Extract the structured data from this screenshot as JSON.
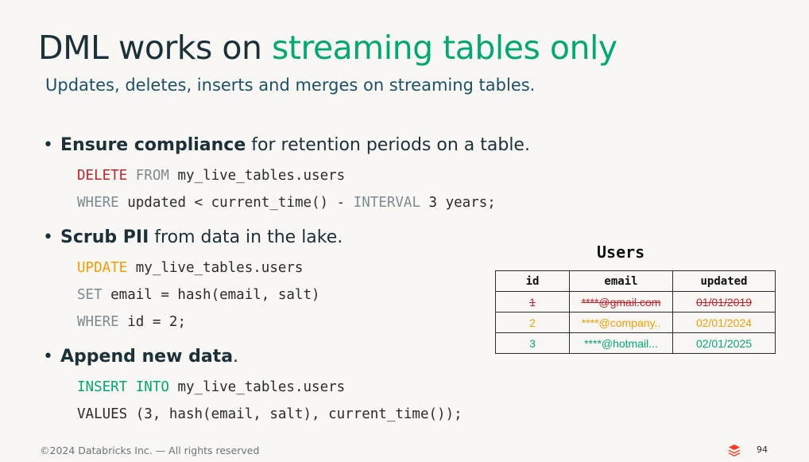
{
  "title": {
    "part1": "DML works on ",
    "part2": "streaming tables only"
  },
  "subtitle": "Updates, deletes, inserts and merges on streaming tables.",
  "bullets": [
    {
      "bold": "Ensure compliance",
      "rest": " for retention periods on a table.",
      "code": [
        [
          {
            "t": "DELETE",
            "c": "red"
          },
          {
            "t": " "
          },
          {
            "t": "FROM",
            "c": "grey"
          },
          {
            "t": " my_live_tables.users"
          }
        ],
        [
          {
            "t": "WHERE",
            "c": "grey"
          },
          {
            "t": " updated < current_time() - "
          },
          {
            "t": "INTERVAL",
            "c": "grey"
          },
          {
            "t": " 3 years;"
          }
        ]
      ]
    },
    {
      "bold": "Scrub PII",
      "rest": " from data in the lake.",
      "code": [
        [
          {
            "t": "UPDATE",
            "c": "orange"
          },
          {
            "t": " my_live_tables.users"
          }
        ],
        [
          {
            "t": "SET",
            "c": "grey"
          },
          {
            "t": " email = hash(email, salt)"
          }
        ],
        [
          {
            "t": "WHERE",
            "c": "grey"
          },
          {
            "t": " id = 2;"
          }
        ]
      ]
    },
    {
      "bold": "Append new data",
      "rest": ".",
      "code": [
        [
          {
            "t": "INSERT",
            "c": "green"
          },
          {
            "t": " "
          },
          {
            "t": "INTO",
            "c": "green"
          },
          {
            "t": " my_live_tables.users"
          }
        ],
        [
          {
            "t": "VALUES (3, hash(email, salt), current_time());"
          }
        ]
      ]
    }
  ],
  "table": {
    "title": "Users",
    "headers": [
      "id",
      "email",
      "updated"
    ],
    "rows": [
      {
        "status": "deleted",
        "cells": [
          "1",
          "****@gmail.com",
          "01/01/2019"
        ]
      },
      {
        "status": "updated",
        "cells": [
          "2",
          "****@company..",
          "02/01/2024"
        ]
      },
      {
        "status": "inserted",
        "cells": [
          "3",
          "****@hotmail...",
          "02/01/2025"
        ]
      }
    ]
  },
  "colors": {
    "accent_green": "#00a972",
    "red": "#c8232c",
    "orange": "#f59c00",
    "grey": "#7d8a91",
    "navy": "#1b3139",
    "brand": "#ff3621"
  },
  "footer": "©2024 Databricks Inc. — All rights reserved",
  "page_number": "94",
  "logo_icon": "databricks-logo-icon"
}
